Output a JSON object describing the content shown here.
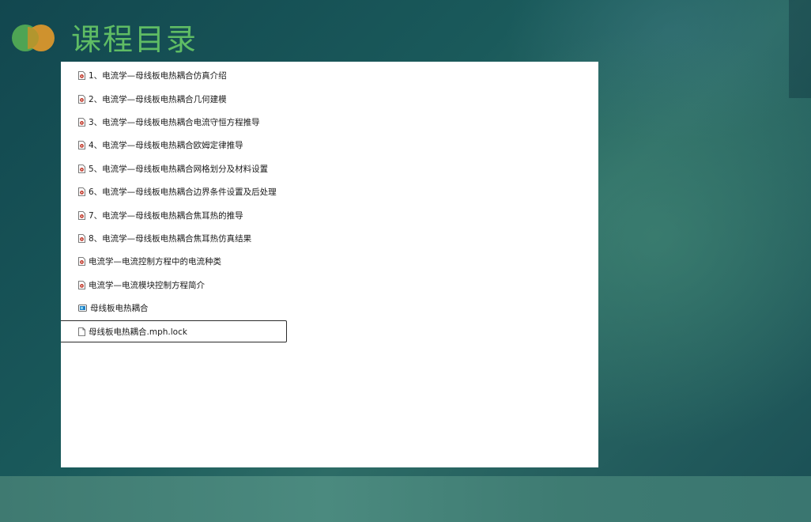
{
  "header": {
    "title": "课程目录"
  },
  "file_list": [
    {
      "label": "1、电流学—母线板电热耦合仿真介绍",
      "icon": "video-file-icon"
    },
    {
      "label": "2、电流学—母线板电热耦合几何建模",
      "icon": "video-file-icon"
    },
    {
      "label": "3、电流学—母线板电热耦合电流守恒方程推导",
      "icon": "video-file-icon"
    },
    {
      "label": "4、电流学—母线板电热耦合欧姆定律推导",
      "icon": "video-file-icon"
    },
    {
      "label": "5、电流学—母线板电热耦合网格划分及材料设置",
      "icon": "video-file-icon"
    },
    {
      "label": "6、电流学—母线板电热耦合边界条件设置及后处理",
      "icon": "video-file-icon"
    },
    {
      "label": "7、电流学—母线板电热耦合焦耳热的推导",
      "icon": "video-file-icon"
    },
    {
      "label": "8、电流学—母线板电热耦合焦耳热仿真结果",
      "icon": "video-file-icon"
    },
    {
      "label": "电流学—电流控制方程中的电流种类",
      "icon": "video-file-icon"
    },
    {
      "label": "电流学—电流模块控制方程简介",
      "icon": "video-file-icon"
    },
    {
      "label": "母线板电热耦合",
      "icon": "comsol-model-icon"
    },
    {
      "label": "母线板电热耦合.mph.lock",
      "icon": "blank-file-icon",
      "selected": true
    }
  ],
  "colors": {
    "title": "#5fbc64",
    "logo_green": "#4ea454",
    "logo_orange": "#d9962c",
    "video_icon_accent": "#c0392b",
    "model_icon_accent": "#1f7fc4"
  }
}
